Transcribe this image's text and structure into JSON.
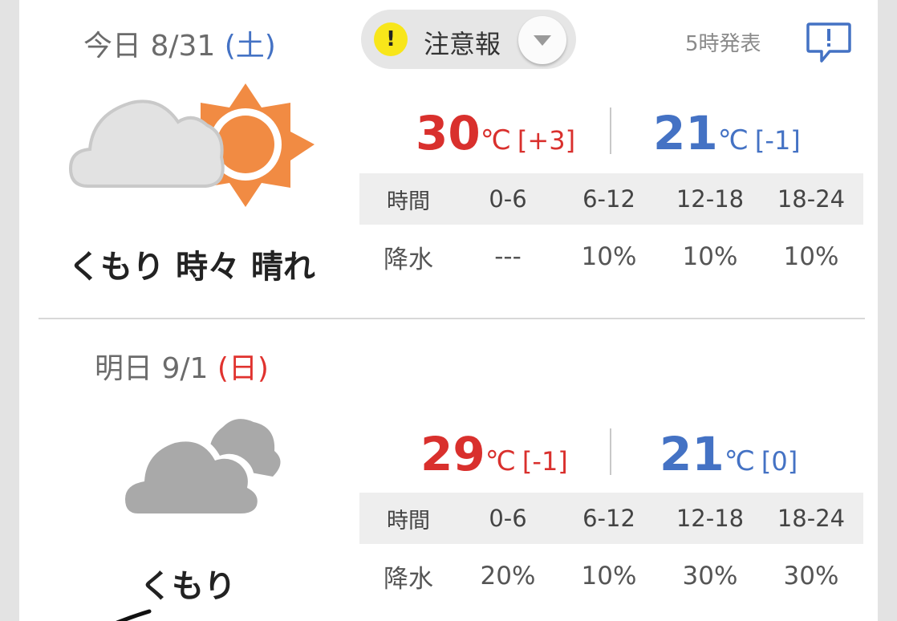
{
  "today": {
    "date_prefix": "今日",
    "date": "8/31",
    "dow": "(土)",
    "dow_color": "#4472c4",
    "weather_icon": "cloudy-sunny-icon",
    "weather": "くもり 時々 晴れ",
    "high": "30",
    "high_unit": "℃",
    "high_diff": "[+3]",
    "low": "21",
    "low_unit": "℃",
    "low_diff": "[-1]",
    "precip": {
      "header_label": "時間",
      "periods": [
        "0-6",
        "6-12",
        "12-18",
        "18-24"
      ],
      "row_label": "降水",
      "values": [
        "---",
        "10%",
        "10%",
        "10%"
      ]
    }
  },
  "alert": {
    "icon": "warning-exclamation-icon",
    "label": "注意報",
    "toggle_icon": "chevron-down-icon"
  },
  "issued_text": "5時発表",
  "feedback_icon": "feedback-speech-bubble-icon",
  "tomorrow": {
    "date_prefix": "明日",
    "date": "9/1",
    "dow": "(日)",
    "dow_color": "#e0322e",
    "weather_icon": "cloudy-icon",
    "weather": "くもり",
    "high": "29",
    "high_unit": "℃",
    "high_diff": "[-1]",
    "low": "21",
    "low_unit": "℃",
    "low_diff": "[0]",
    "precip": {
      "header_label": "時間",
      "periods": [
        "0-6",
        "6-12",
        "12-18",
        "18-24"
      ],
      "row_label": "降水",
      "values": [
        "20%",
        "10%",
        "30%",
        "30%"
      ]
    }
  },
  "colors": {
    "high": "#d9302d",
    "low": "#4472c4",
    "sun": "#f18b43",
    "cloud_light": "#e2e2e2",
    "cloud_gray": "#a9a9a9"
  }
}
